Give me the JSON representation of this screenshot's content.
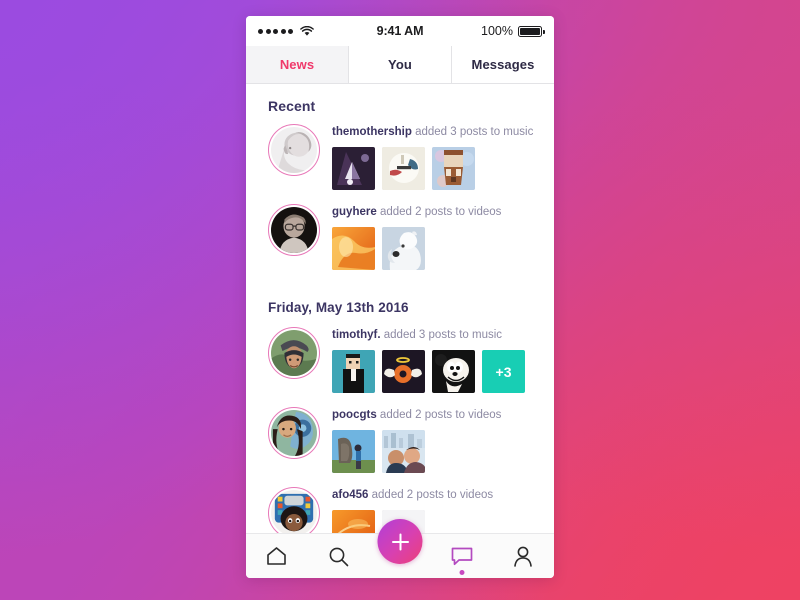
{
  "background": {
    "gradient_top_left": "#9B4BE0",
    "gradient_top_right": "#D4458E",
    "gradient_bottom_left": "#BC45B8",
    "gradient_bottom_right": "#EE4263"
  },
  "status_bar": {
    "signal_dots": 5,
    "wifi_icon": "wifi-icon",
    "time": "9:41 AM",
    "battery_percent": "100%",
    "battery_icon": "battery-full-icon"
  },
  "tabs": [
    {
      "label": "News",
      "active": true
    },
    {
      "label": "You",
      "active": false
    },
    {
      "label": "Messages",
      "active": false
    }
  ],
  "accent": {
    "active_tab_color": "#f0396b",
    "heading_color": "#3c3563",
    "muted_text_color": "#8d8aa3",
    "more_badge_color": "#18ceb4",
    "avatar_ring_color": "#e878b8",
    "nav_active_color": "#c849c0"
  },
  "feed": {
    "sections": [
      {
        "title": "Recent",
        "items": [
          {
            "username": "themothership",
            "action": " added 3 posts to music",
            "avatar": "avatar-themothership",
            "thumbs": [
              "thumb-triangle-art",
              "thumb-found-glory",
              "thumb-beard-face"
            ],
            "more_count": null
          },
          {
            "username": "guyhere",
            "action": " added 2 posts to videos",
            "avatar": "avatar-guyhere",
            "thumbs": [
              "thumb-orange-fire",
              "thumb-white-bear"
            ],
            "more_count": null
          }
        ]
      },
      {
        "title": "Friday, May 13th 2016",
        "items": [
          {
            "username": "timothyf.",
            "action": " added 3 posts to music",
            "avatar": "avatar-timothyf",
            "thumbs": [
              "thumb-pixel-man",
              "thumb-winged-donut",
              "thumb-cartoon-mouse"
            ],
            "more_count": "+3"
          },
          {
            "username": "poocgts",
            "action": " added 2 posts to videos",
            "avatar": "avatar-poocgts",
            "thumbs": [
              "thumb-moai-statue",
              "thumb-couple-city"
            ],
            "more_count": null
          },
          {
            "username": "afo456",
            "action": " added 2 posts to videos",
            "avatar": "avatar-afo456",
            "thumbs": [
              "thumb-orange-swirl",
              "thumb-magenta-circle"
            ],
            "more_count": null
          }
        ]
      }
    ]
  },
  "bottom_nav": {
    "items": [
      {
        "name": "home-icon",
        "label": "Home",
        "active": false
      },
      {
        "name": "search-icon",
        "label": "Search",
        "active": false
      },
      {
        "name": "add-icon",
        "label": "Add",
        "active": false
      },
      {
        "name": "chat-icon",
        "label": "Messages",
        "active": true
      },
      {
        "name": "profile-icon",
        "label": "Profile",
        "active": false
      }
    ]
  }
}
